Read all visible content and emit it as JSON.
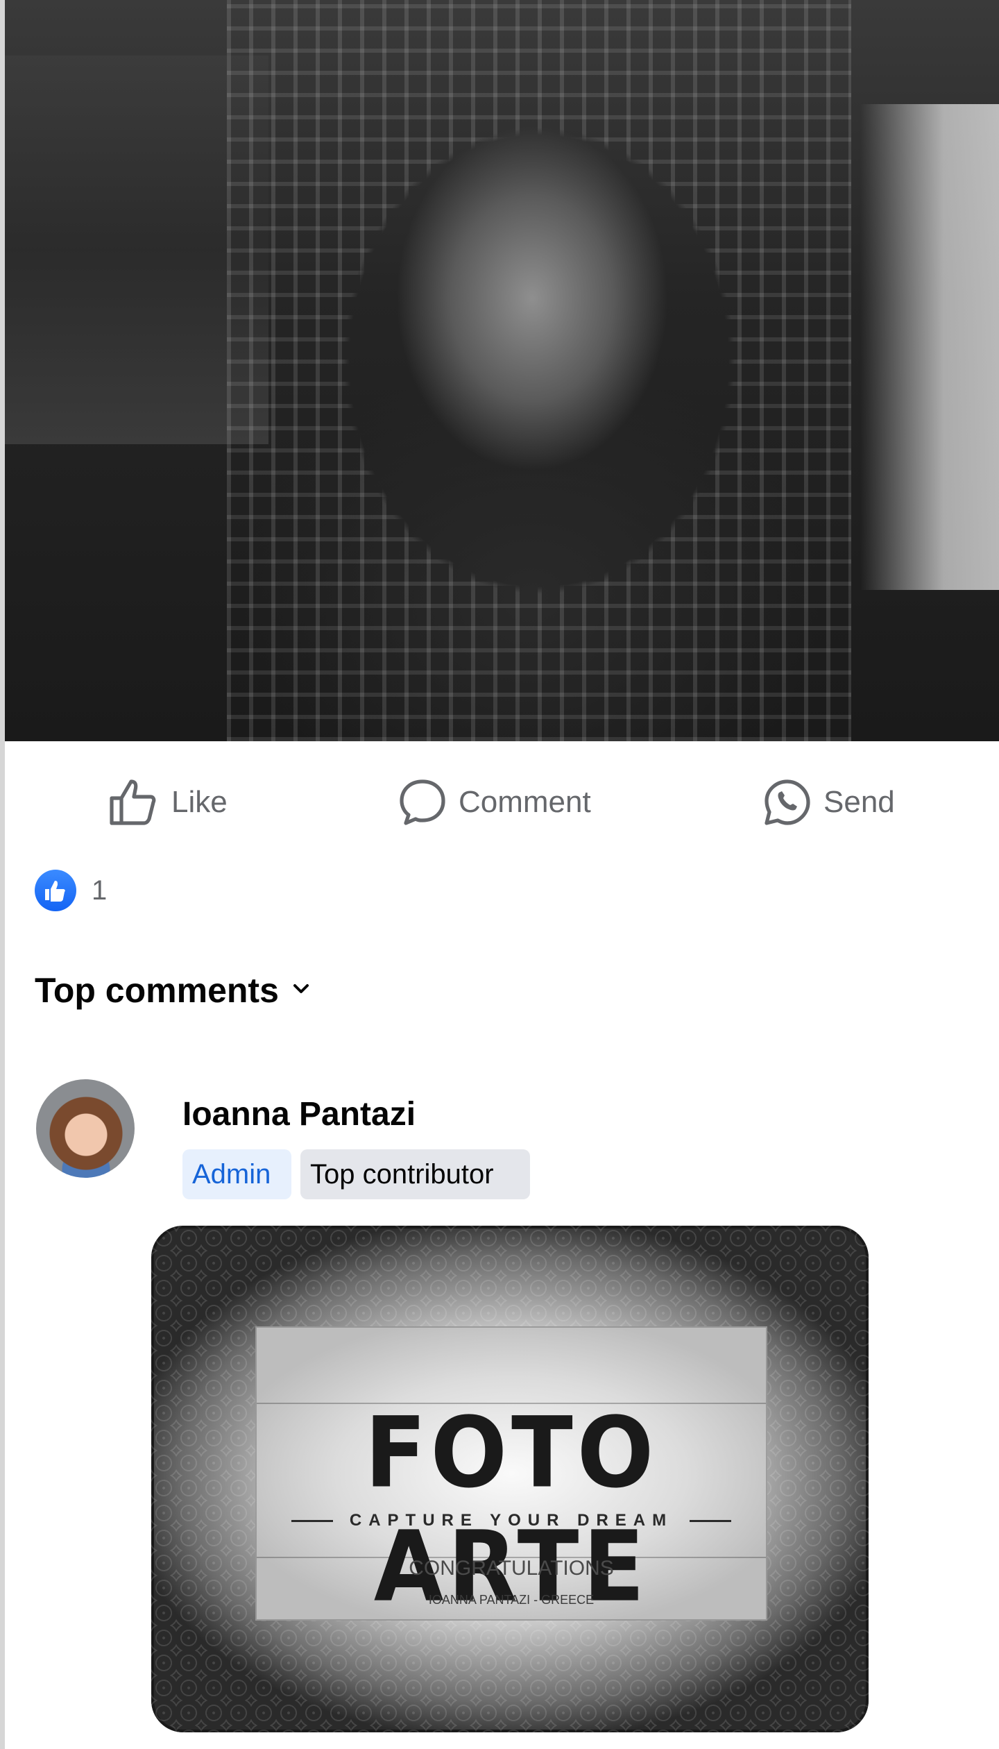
{
  "post": {
    "photo_alt": ""
  },
  "actions": {
    "like_label": "Like",
    "comment_label": "Comment",
    "send_label": "Send"
  },
  "reactions": {
    "count": "1",
    "type": "like-icon",
    "color": "#1877f2"
  },
  "comments_section": {
    "sort_label": "Top comments"
  },
  "comment": {
    "author": "Ioanna Pantazi",
    "badges": [
      "Admin",
      "Top contributor"
    ],
    "image": {
      "title": "FOTO ARTE",
      "tagline": "CAPTURE YOUR DREAM",
      "congrats": "CONGRATULATIONS",
      "winner": "IOANNA PANTAZI - GREECE"
    }
  },
  "colors": {
    "secondary_text": "#65676b",
    "admin_badge_bg": "#e7f0fd",
    "admin_badge_text": "#1664d8",
    "contributor_badge_bg": "#e4e6eb"
  }
}
